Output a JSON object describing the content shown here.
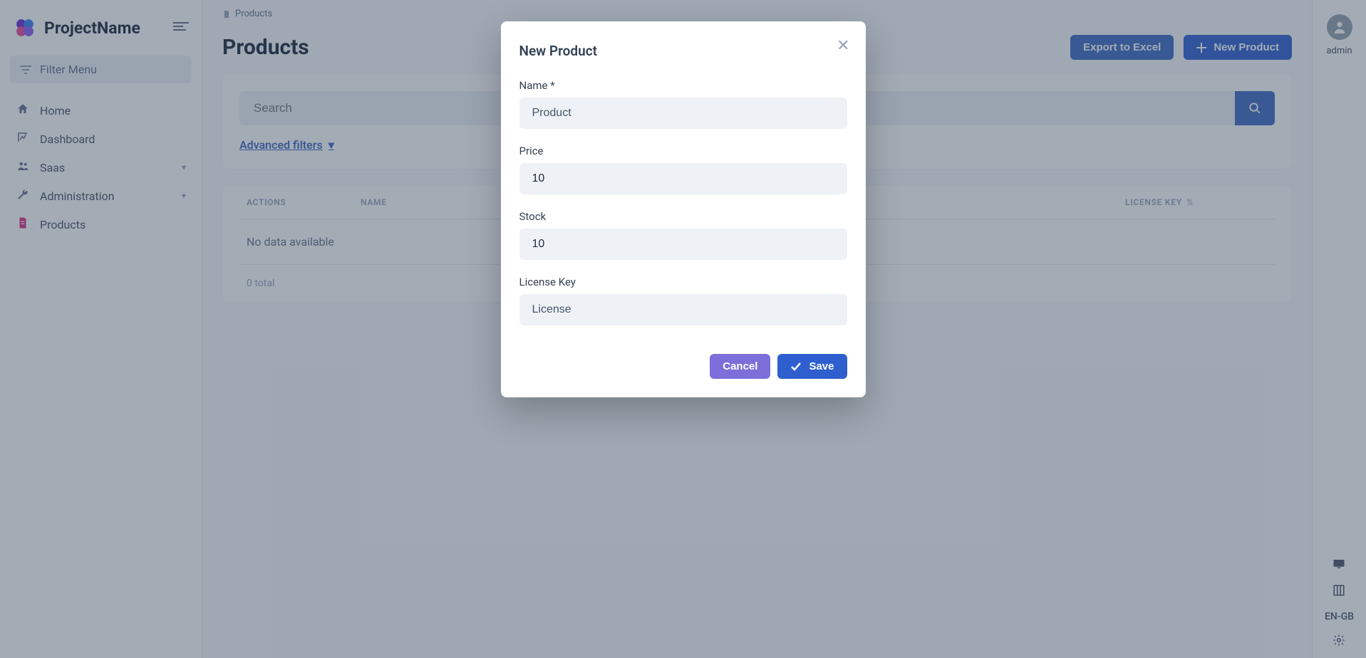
{
  "brand": {
    "title": "ProjectName"
  },
  "sidebar": {
    "filter_placeholder": "Filter Menu",
    "items": [
      {
        "label": "Home"
      },
      {
        "label": "Dashboard"
      },
      {
        "label": "Saas"
      },
      {
        "label": "Administration"
      },
      {
        "label": "Products"
      }
    ]
  },
  "breadcrumb": {
    "label": "Products"
  },
  "page": {
    "title": "Products",
    "export_label": "Export to Excel",
    "new_label": "New Product"
  },
  "search": {
    "placeholder": "Search",
    "advanced_label": "Advanced filters "
  },
  "table": {
    "columns": {
      "actions": "ACTIONS",
      "name": "NAME",
      "license": "LICENSE KEY"
    },
    "empty": "No data available",
    "total": "0 total"
  },
  "user": {
    "name": "admin"
  },
  "locale": "EN-GB",
  "modal": {
    "title": "New Product",
    "fields": {
      "name_label": "Name *",
      "name_placeholder": "Product",
      "price_label": "Price",
      "price_value": "10",
      "stock_label": "Stock",
      "stock_value": "10",
      "license_label": "License Key",
      "license_placeholder": "License"
    },
    "cancel_label": "Cancel",
    "save_label": "Save"
  }
}
